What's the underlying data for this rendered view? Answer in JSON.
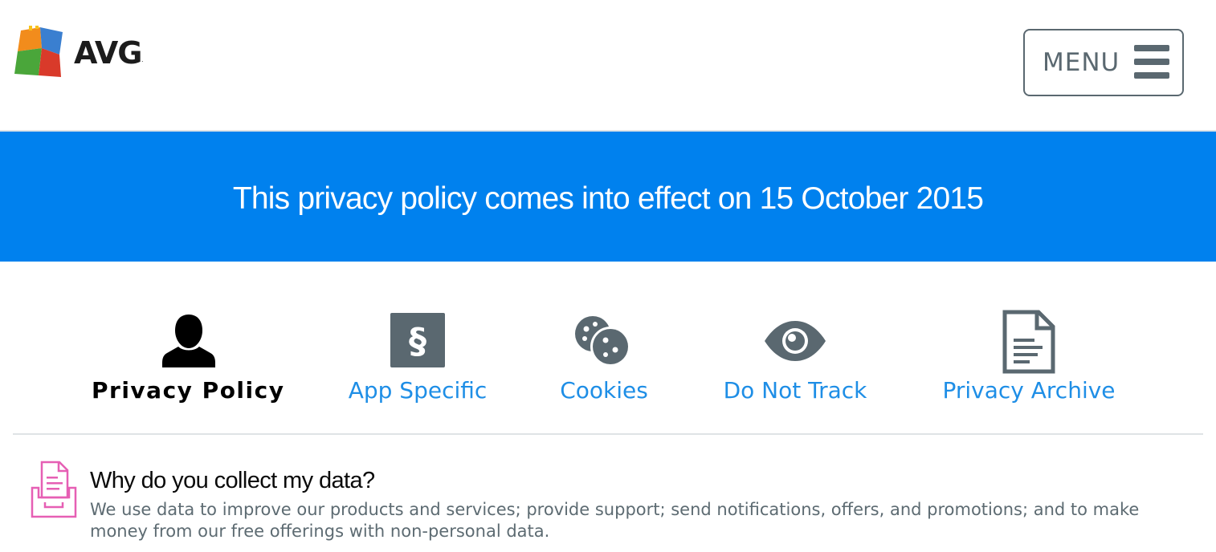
{
  "header": {
    "logo_text": "AVG",
    "logo_tm": ".",
    "menu_label": "MENU"
  },
  "banner": {
    "text": "This privacy policy comes into effect on 15 October 2015"
  },
  "nav": {
    "items": [
      {
        "label": "Privacy Policy",
        "icon": "person-icon",
        "active": true
      },
      {
        "label": "App Specific",
        "icon": "section-icon",
        "active": false
      },
      {
        "label": "Cookies",
        "icon": "cookie-icon",
        "active": false
      },
      {
        "label": "Do Not Track",
        "icon": "eye-icon",
        "active": false
      },
      {
        "label": "Privacy Archive",
        "icon": "document-icon",
        "active": false
      }
    ]
  },
  "info": {
    "icon": "inbox-document-icon",
    "title": "Why do you collect my data?",
    "body": "We use data to improve our products and services; provide support; send notifications, offers, and promotions; and to make money from our free offerings with non-personal data."
  },
  "colors": {
    "banner": "#0081ee",
    "link": "#1e8ee6",
    "icon_gray": "#5a6870",
    "accent_pink": "#e65fb4"
  }
}
